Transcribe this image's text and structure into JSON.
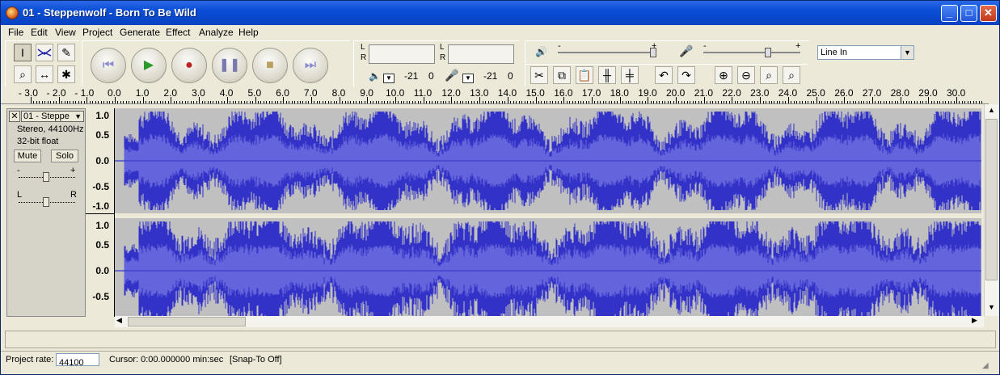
{
  "window": {
    "title": "01 - Steppenwolf - Born To Be Wild"
  },
  "menu": [
    "File",
    "Edit",
    "View",
    "Project",
    "Generate",
    "Effect",
    "Analyze",
    "Help"
  ],
  "tools": {
    "icons": [
      "selection-tool-icon",
      "envelope-tool-icon",
      "draw-tool-icon",
      "zoom-tool-icon",
      "timeshift-tool-icon",
      "multi-tool-icon"
    ]
  },
  "transport": {
    "icons": [
      "skip-start-icon",
      "play-icon",
      "record-icon",
      "pause-icon",
      "stop-icon",
      "skip-end-icon"
    ]
  },
  "meters": {
    "play_L": "L",
    "play_R": "R",
    "rec_L": "L",
    "rec_R": "R",
    "play_db": "-21",
    "play_zero": "0",
    "rec_db": "-21",
    "rec_zero": "0"
  },
  "mixer": {
    "out_minus": "-",
    "out_plus": "+",
    "in_minus": "-",
    "in_plus": "+",
    "input_source": "Line In"
  },
  "ruler": {
    "ticks": [
      "- 3.0",
      "- 2.0",
      "- 1.0",
      "0.0",
      "1.0",
      "2.0",
      "3.0",
      "4.0",
      "5.0",
      "6.0",
      "7.0",
      "8.0",
      "9.0",
      "10.0",
      "11.0",
      "12.0",
      "13.0",
      "14.0",
      "15.0",
      "16.0",
      "17.0",
      "18.0",
      "19.0",
      "20.0",
      "21.0",
      "22.0",
      "23.0",
      "24.0",
      "25.0",
      "26.0",
      "27.0",
      "28.0",
      "29.0",
      "30.0"
    ]
  },
  "track": {
    "name": "01 - Steppe",
    "format": "Stereo, 44100Hz",
    "bitdepth": "32-bit float",
    "mute": "Mute",
    "solo": "Solo",
    "gain_minus": "-",
    "gain_plus": "+",
    "pan_left": "L",
    "pan_right": "R"
  },
  "vruler": {
    "ch1": [
      "1.0",
      "0.5",
      "0.0",
      "-0.5",
      "-1.0"
    ],
    "ch2": [
      "1.0",
      "0.5",
      "0.0",
      "-0.5"
    ]
  },
  "status": {
    "rate_label": "Project rate:",
    "rate_value": "44100",
    "cursor": "Cursor: 0:00.000000 min:sec",
    "snap": "[Snap-To Off]"
  },
  "colors": {
    "wave_peak": "#3232c8",
    "wave_rms": "#6464dc",
    "wave_bg": "#c0c0c0"
  }
}
